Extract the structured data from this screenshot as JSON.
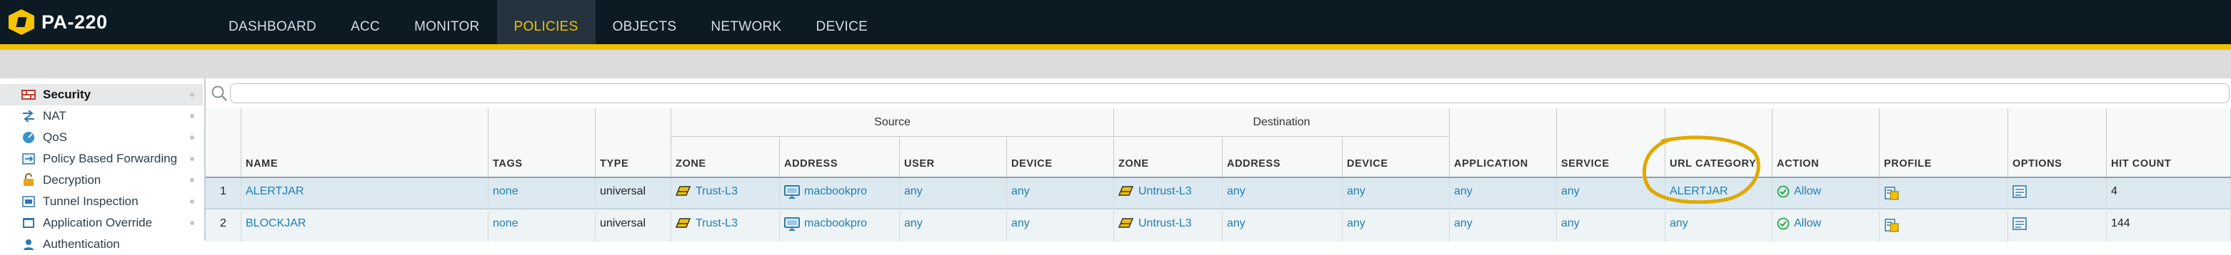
{
  "brand": {
    "title": "PA-220"
  },
  "nav": {
    "tabs": [
      {
        "label": "DASHBOARD"
      },
      {
        "label": "ACC"
      },
      {
        "label": "MONITOR"
      },
      {
        "label": "POLICIES"
      },
      {
        "label": "OBJECTS"
      },
      {
        "label": "NETWORK"
      },
      {
        "label": "DEVICE"
      }
    ],
    "active": "POLICIES"
  },
  "colors": {
    "accent": "#f2c200",
    "topbar": "#0c1a24",
    "link": "#1e7fb8",
    "highlight": "#e0a800"
  },
  "sidebar": {
    "items": [
      {
        "label": "Security",
        "icon": "security-rules-icon"
      },
      {
        "label": "NAT",
        "icon": "nat-icon"
      },
      {
        "label": "QoS",
        "icon": "qos-icon"
      },
      {
        "label": "Policy Based Forwarding",
        "icon": "pbf-icon"
      },
      {
        "label": "Decryption",
        "icon": "decryption-icon"
      },
      {
        "label": "Tunnel Inspection",
        "icon": "tunnel-icon"
      },
      {
        "label": "Application Override",
        "icon": "app-override-icon"
      },
      {
        "label": "Authentication",
        "icon": "authentication-icon"
      }
    ]
  },
  "search": {
    "value": ""
  },
  "table": {
    "groups": {
      "source": "Source",
      "destination": "Destination"
    },
    "headers": {
      "name": "NAME",
      "tags": "TAGS",
      "type": "TYPE",
      "src_zone": "ZONE",
      "src_address": "ADDRESS",
      "src_user": "USER",
      "src_device": "DEVICE",
      "dst_zone": "ZONE",
      "dst_address": "ADDRESS",
      "dst_device": "DEVICE",
      "application": "APPLICATION",
      "service": "SERVICE",
      "url_category": "URL CATEGORY",
      "action": "ACTION",
      "profile": "PROFILE",
      "options": "OPTIONS",
      "hit_count": "HIT COUNT"
    },
    "rows": [
      {
        "num": "1",
        "name": "ALERTJAR",
        "tags": "none",
        "type": "universal",
        "src_zone": "Trust-L3",
        "src_address": "macbookpro",
        "src_user": "any",
        "src_device": "any",
        "dst_zone": "Untrust-L3",
        "dst_address": "any",
        "dst_device": "any",
        "application": "any",
        "service": "any",
        "url_category": "ALERTJAR",
        "action": "Allow",
        "hit_count": "4"
      },
      {
        "num": "2",
        "name": "BLOCKJAR",
        "tags": "none",
        "type": "universal",
        "src_zone": "Trust-L3",
        "src_address": "macbookpro",
        "src_user": "any",
        "src_device": "any",
        "dst_zone": "Untrust-L3",
        "dst_address": "any",
        "dst_device": "any",
        "application": "any",
        "service": "any",
        "url_category": "any",
        "action": "Allow",
        "hit_count": "144"
      }
    ]
  }
}
